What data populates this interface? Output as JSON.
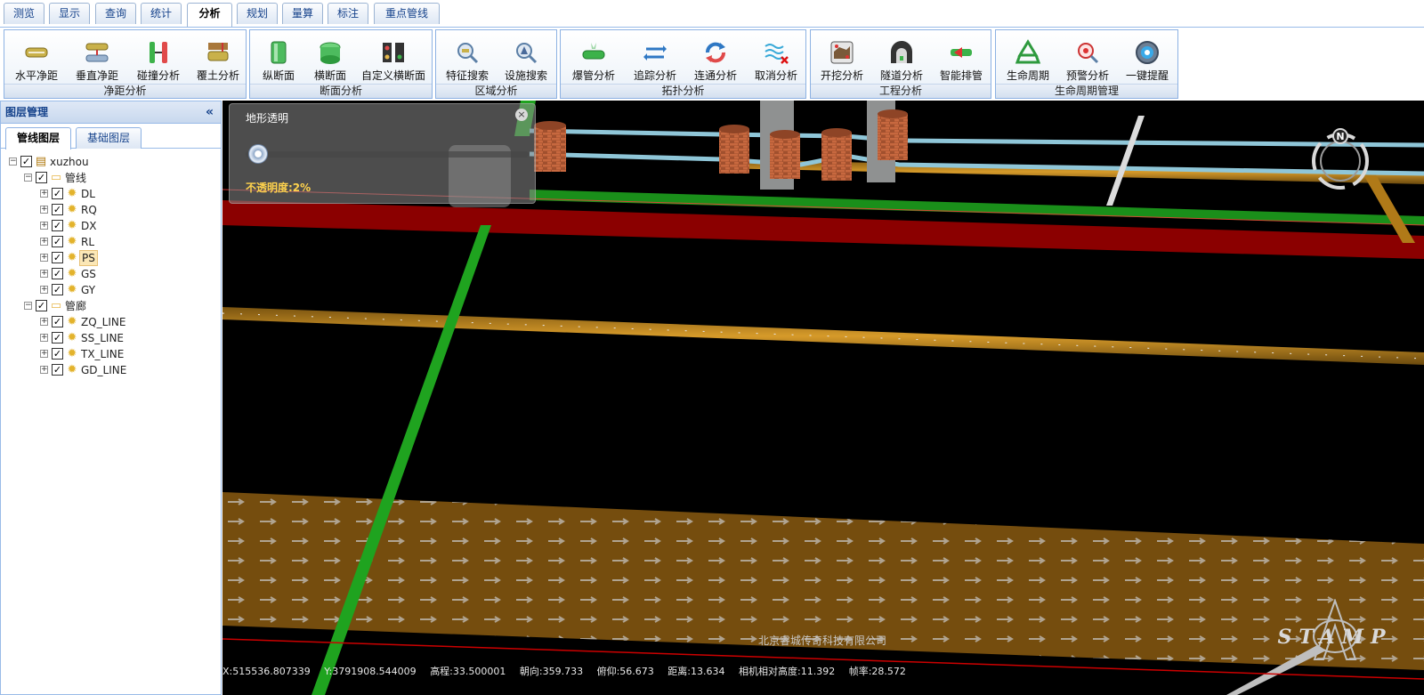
{
  "tabs": [
    "测览",
    "显示",
    "查询",
    "统计",
    "分析",
    "规划",
    "量算",
    "标注",
    "重点管线"
  ],
  "active_tab": "分析",
  "ribbon": {
    "groups": [
      {
        "title": "净距分析",
        "buttons": [
          "水平净距",
          "垂直净距",
          "碰撞分析",
          "覆土分析"
        ]
      },
      {
        "title": "断面分析",
        "buttons": [
          "纵断面",
          "横断面",
          "自定义横断面"
        ]
      },
      {
        "title": "区域分析",
        "buttons": [
          "特征搜索",
          "设施搜索"
        ]
      },
      {
        "title": "拓扑分析",
        "buttons": [
          "爆管分析",
          "追踪分析",
          "连通分析",
          "取消分析"
        ]
      },
      {
        "title": "工程分析",
        "buttons": [
          "开挖分析",
          "隧道分析",
          "智能排管"
        ]
      },
      {
        "title": "生命周期管理",
        "buttons": [
          "生命周期",
          "预警分析",
          "一键提醒"
        ]
      }
    ]
  },
  "left_panel": {
    "title": "图层管理",
    "collapse_icon": "double-chevron-left-icon",
    "tabs": [
      "管线图层",
      "基础图层"
    ],
    "tree": {
      "root": "xuzhou",
      "groups": [
        {
          "label": "管线",
          "items": [
            "DL",
            "RQ",
            "DX",
            "RL",
            "PS",
            "GS",
            "GY"
          ]
        },
        {
          "label": "管廊",
          "items": [
            "ZQ_LINE",
            "SS_LINE",
            "TX_LINE",
            "GD_LINE"
          ]
        }
      ],
      "selected": "PS"
    }
  },
  "viewport": {
    "terrain_panel": {
      "title": "地形透明",
      "opacity_text": "不透明度:2%",
      "opacity_value": 0.02
    },
    "company": "北京睿城传奇科技有限公司",
    "logo_text": "STAMP",
    "compass_label": "N",
    "status": {
      "x": "X:515536.807339",
      "y": "Y:3791908.544009",
      "elevation": "高程:33.500001",
      "heading": "朝向:359.733",
      "pitch": "俯仰:56.673",
      "distance": "距离:13.634",
      "camera_height": "相机相对高度:11.392",
      "fps": "帧率:28.572"
    }
  },
  "colors": {
    "tab_text": "#15428b",
    "panel_border": "#99bbe8",
    "pipe_orange": "#c08a1e",
    "pipe_green": "#1fa31f",
    "pipe_red": "#a00000",
    "pipe_blue": "#8fc6d8"
  }
}
